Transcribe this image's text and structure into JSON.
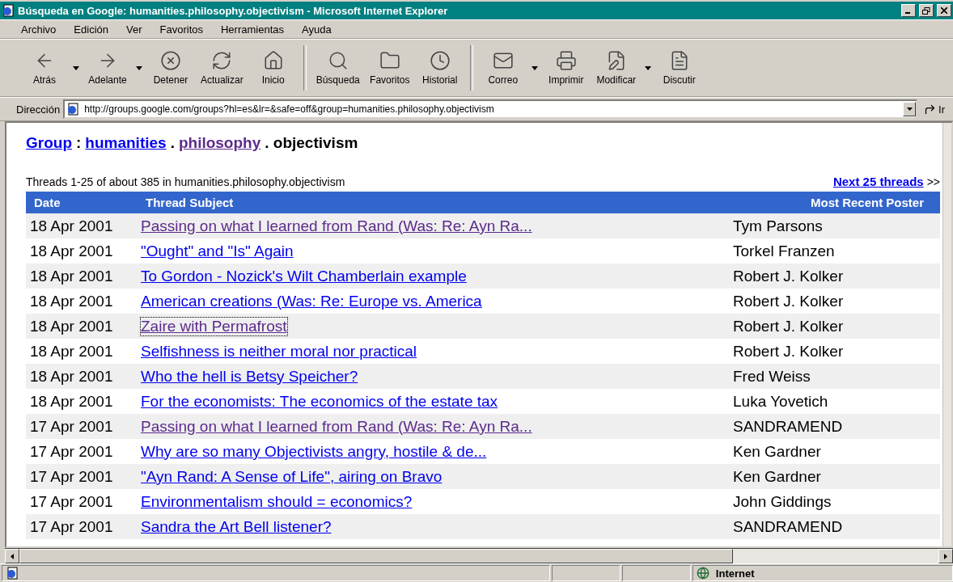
{
  "window": {
    "title": "Búsqueda en Google: humanities.philosophy.objectivism - Microsoft Internet Explorer"
  },
  "menu": [
    "Archivo",
    "Edición",
    "Ver",
    "Favoritos",
    "Herramientas",
    "Ayuda"
  ],
  "toolbar": [
    {
      "label": "Atrás",
      "dropdown": true
    },
    {
      "label": "Adelante",
      "dropdown": true
    },
    {
      "label": "Detener",
      "dropdown": false
    },
    {
      "label": "Actualizar",
      "dropdown": false
    },
    {
      "label": "Inicio",
      "dropdown": false
    },
    {
      "label": "Búsqueda",
      "dropdown": false
    },
    {
      "label": "Favoritos",
      "dropdown": false
    },
    {
      "label": "Historial",
      "dropdown": false
    },
    {
      "label": "Correo",
      "dropdown": true
    },
    {
      "label": "Imprimir",
      "dropdown": false
    },
    {
      "label": "Modificar",
      "dropdown": true
    },
    {
      "label": "Discutir",
      "dropdown": false
    }
  ],
  "address": {
    "label": "Dirección",
    "value": "http://groups.google.com/groups?hl=es&lr=&safe=off&group=humanities.philosophy.objectivism",
    "go": "Ir"
  },
  "breadcrumb": [
    {
      "text": "Group",
      "kind": "link",
      "visited": false
    },
    {
      "text": ":",
      "kind": "text"
    },
    {
      "text": "humanities",
      "kind": "link",
      "visited": false
    },
    {
      "text": ".",
      "kind": "text"
    },
    {
      "text": "philosophy",
      "kind": "link",
      "visited": true
    },
    {
      "text": ". objectivism",
      "kind": "text"
    }
  ],
  "summary": "Threads 1-25 of about 385 in humanities.philosophy.objectivism",
  "next": {
    "link": "Next 25 threads",
    "arrows": ">>"
  },
  "table": {
    "columns": [
      "Date",
      "Thread Subject",
      "Most Recent Poster"
    ],
    "rows": [
      {
        "date": "18 Apr 2001",
        "subject": "Passing on what I learned from Rand (Was: Re: Ayn Ra...",
        "poster": "Tym Parsons",
        "visited": true,
        "focused": false
      },
      {
        "date": "18 Apr 2001",
        "subject": "\"Ought\" and \"Is\" Again",
        "poster": "Torkel Franzen",
        "visited": false,
        "focused": false
      },
      {
        "date": "18 Apr 2001",
        "subject": "To Gordon - Nozick's Wilt Chamberlain example",
        "poster": "Robert J. Kolker",
        "visited": false,
        "focused": false
      },
      {
        "date": "18 Apr 2001",
        "subject": "American creations (Was: Re: Europe vs. America",
        "poster": "Robert J. Kolker",
        "visited": false,
        "focused": false
      },
      {
        "date": "18 Apr 2001",
        "subject": "Zaire with Permafrost",
        "poster": "Robert J. Kolker",
        "visited": true,
        "focused": true
      },
      {
        "date": "18 Apr 2001",
        "subject": "Selfishness is neither moral nor practical",
        "poster": "Robert J. Kolker",
        "visited": false,
        "focused": false
      },
      {
        "date": "18 Apr 2001",
        "subject": "Who the hell is Betsy Speicher?",
        "poster": "Fred Weiss",
        "visited": false,
        "focused": false
      },
      {
        "date": "18 Apr 2001",
        "subject": "For the economists: The economics of the estate tax",
        "poster": "Luka Yovetich",
        "visited": false,
        "focused": false
      },
      {
        "date": "17 Apr 2001",
        "subject": "Passing on what I learned from Rand (Was: Re: Ayn Ra...",
        "poster": "SANDRAMEND",
        "visited": true,
        "focused": false
      },
      {
        "date": "17 Apr 2001",
        "subject": "Why are so many Objectivists angry, hostile & de...",
        "poster": "Ken Gardner",
        "visited": false,
        "focused": false
      },
      {
        "date": "17 Apr 2001",
        "subject": "\"Ayn Rand: A Sense of Life\", airing on Bravo",
        "poster": "Ken Gardner",
        "visited": false,
        "focused": false
      },
      {
        "date": "17 Apr 2001",
        "subject": "Environmentalism should = economics?",
        "poster": "John Giddings",
        "visited": false,
        "focused": false
      },
      {
        "date": "17 Apr 2001",
        "subject": "Sandra the Art Bell listener?",
        "poster": "SANDRAMEND",
        "visited": false,
        "focused": false
      }
    ]
  },
  "status_bar": {
    "zone": "Internet"
  }
}
